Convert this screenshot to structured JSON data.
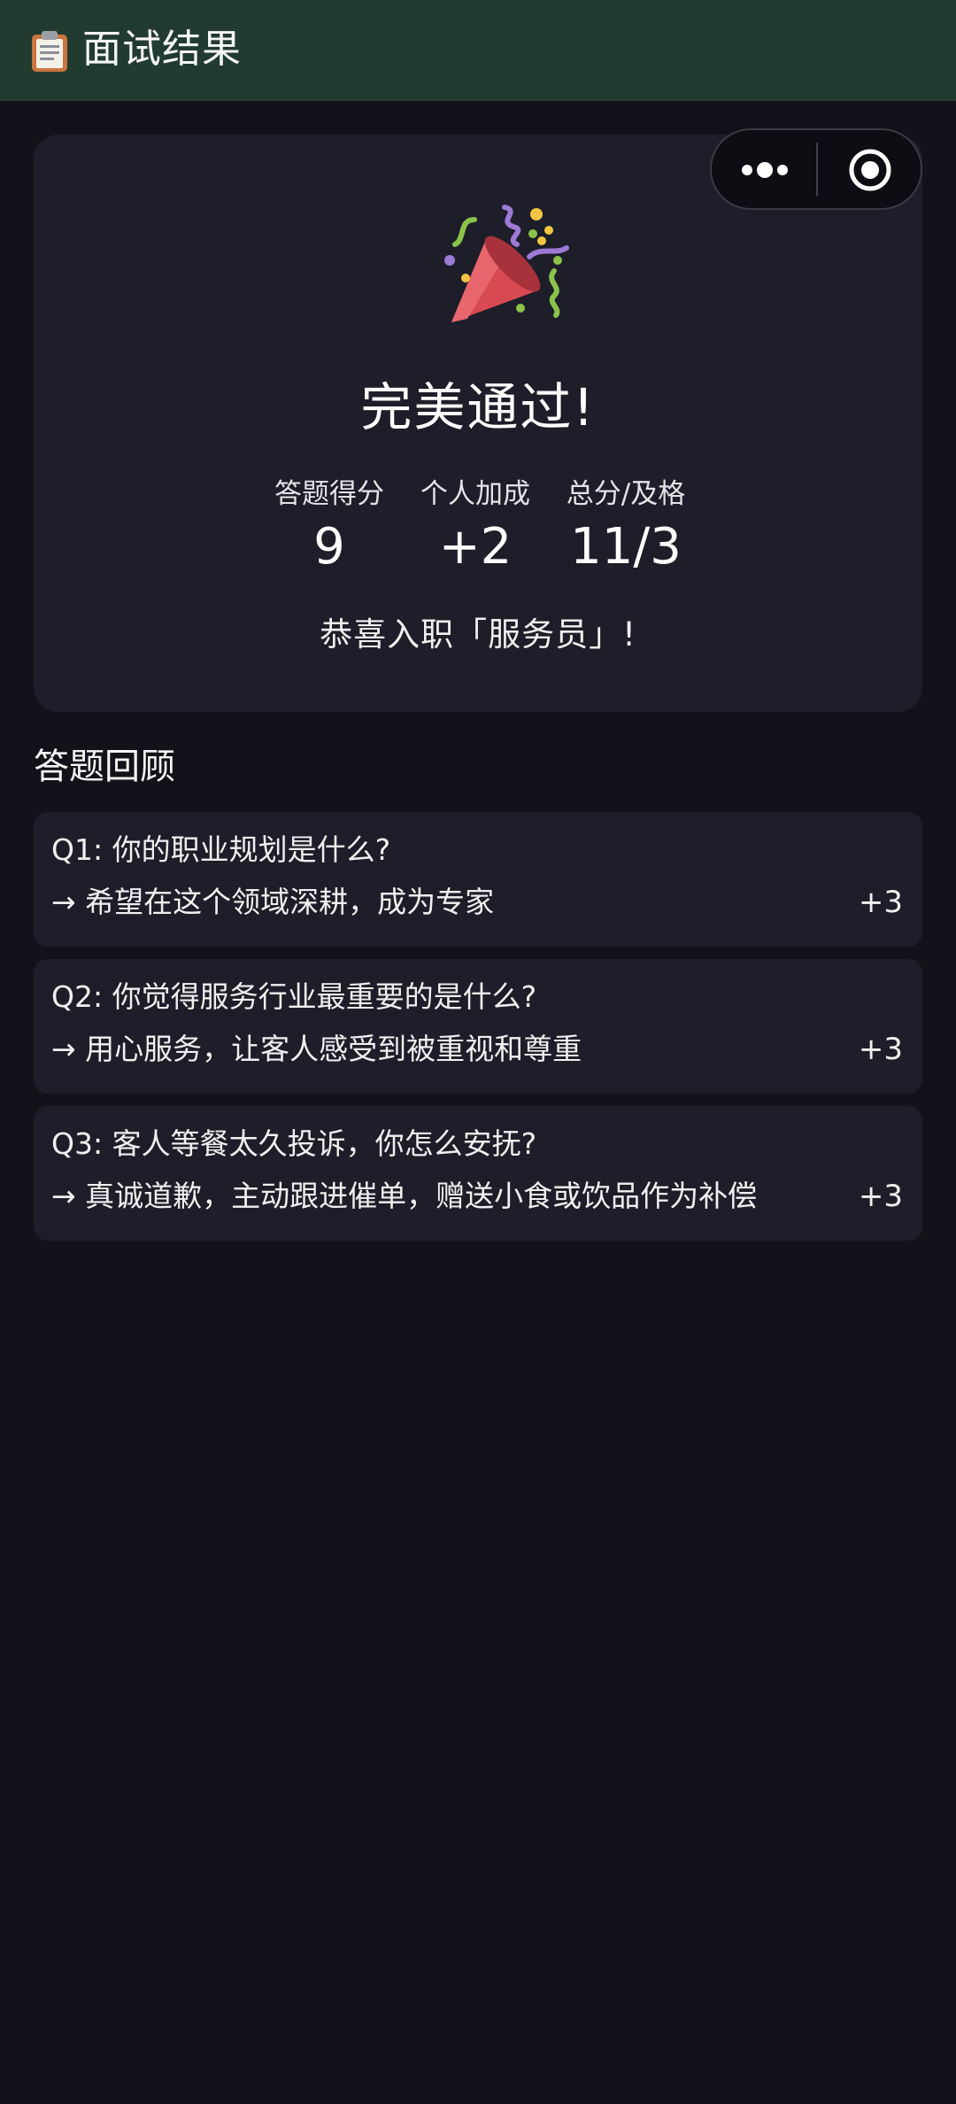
{
  "header": {
    "icon": "clipboard-icon",
    "title": "面试结果"
  },
  "capsule": {
    "more_icon": "more-dots-icon",
    "close_icon": "target-circle-icon"
  },
  "result": {
    "icon": "party-popper-icon",
    "title": "完美通过!",
    "stats": [
      {
        "label": "答题得分",
        "value": "9"
      },
      {
        "label": "个人加成",
        "value": "+2"
      },
      {
        "label": "总分/及格",
        "value": "11/3"
      }
    ],
    "congrats": "恭喜入职「服务员」!"
  },
  "review": {
    "heading": "答题回顾",
    "items": [
      {
        "question": "Q1: 你的职业规划是什么?",
        "answer": "→ 希望在这个领域深耕，成为专家",
        "score": "+3"
      },
      {
        "question": "Q2: 你觉得服务行业最重要的是什么?",
        "answer": "→ 用心服务，让客人感受到被重视和尊重",
        "score": "+3"
      },
      {
        "question": "Q3: 客人等餐太久投诉，你怎么安抚?",
        "answer": "→ 真诚道歉，主动跟进催单，赠送小食或饮品作为补偿",
        "score": "+3"
      }
    ]
  },
  "colors": {
    "header_bg": "#223b30",
    "page_bg": "#12131a",
    "card_bg": "#1d1e29"
  }
}
